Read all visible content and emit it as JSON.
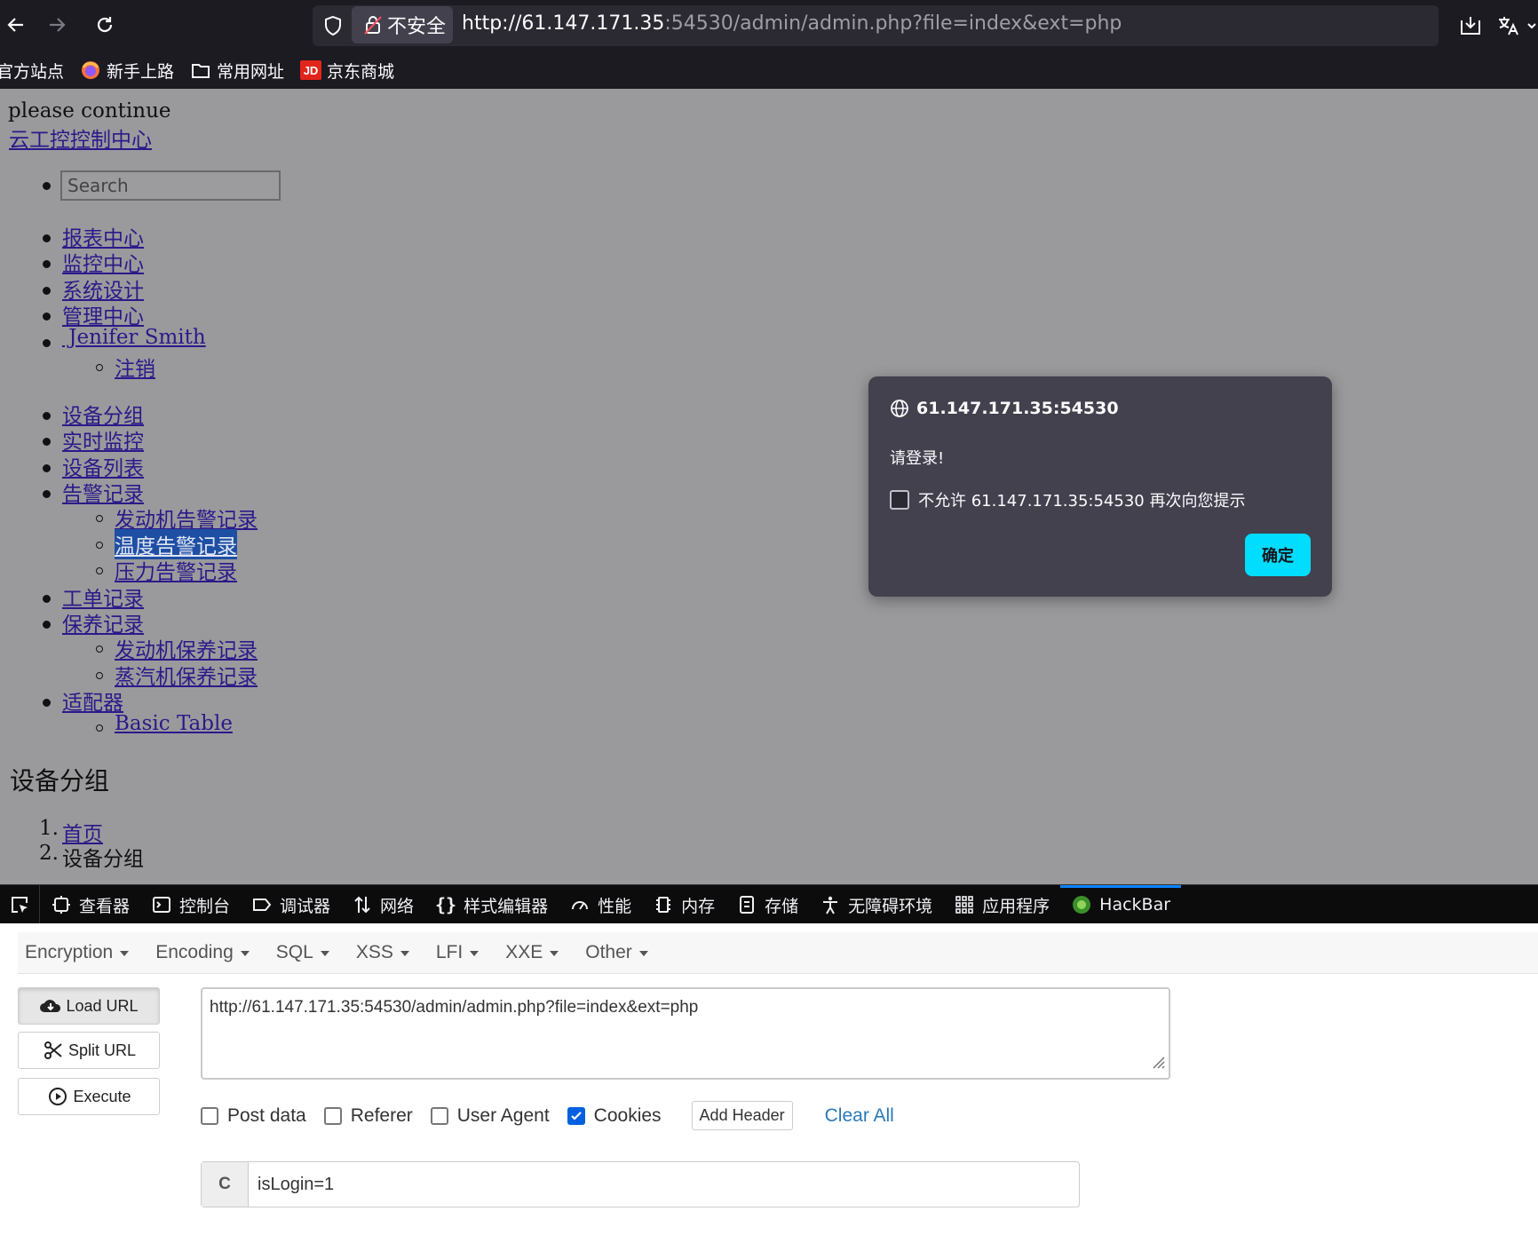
{
  "browser": {
    "security_label": "不安全",
    "url_host": "http://61.147.171.35",
    "url_rest": ":54530/admin/admin.php?file=index&ext=php",
    "bookmarks": [
      "官方站点",
      "新手上路",
      "常用网址",
      "京东商城"
    ]
  },
  "page": {
    "message": "please continue",
    "site_title": "云工控控制中心",
    "search_placeholder": "Search",
    "top_nav": [
      "报表中心",
      "监控中心",
      "系统设计",
      "管理中心",
      " Jenifer Smith"
    ],
    "user_sub": [
      "注销"
    ],
    "side_nav": {
      "device_group": "设备分组",
      "realtime": "实时监控",
      "device_list": "设备列表",
      "alarm": "告警记录",
      "alarm_sub": [
        "发动机告警记录",
        "温度告警记录",
        "压力告警记录"
      ],
      "work_order": "工单记录",
      "maintenance": "保养记录",
      "maintenance_sub": [
        "发动机保养记录",
        "蒸汽机保养记录"
      ],
      "adapter": "适配器",
      "adapter_sub": [
        "Basic Table"
      ]
    },
    "heading": "设备分组",
    "breadcrumb": [
      {
        "num": "1.",
        "label": "首页"
      },
      {
        "num": "2.",
        "label": "设备分组"
      }
    ]
  },
  "dialog": {
    "origin": "61.147.171.35:54530",
    "message": "请登录!",
    "checkbox_label": "不允许 61.147.171.35:54530 再次向您提示",
    "ok_label": "确定"
  },
  "devtools": {
    "tabs": [
      "查看器",
      "控制台",
      "调试器",
      "网络",
      "样式编辑器",
      "性能",
      "内存",
      "存储",
      "无障碍环境",
      "应用程序",
      "HackBar"
    ],
    "active_tab": "HackBar"
  },
  "hackbar": {
    "menus": [
      "Encryption",
      "Encoding",
      "SQL",
      "XSS",
      "LFI",
      "XXE",
      "Other"
    ],
    "buttons": {
      "load": "Load URL",
      "split": "Split URL",
      "execute": "Execute"
    },
    "url_value": "http://61.147.171.35:54530/admin/admin.php?file=index&ext=php",
    "options": [
      {
        "label": "Post data",
        "checked": false
      },
      {
        "label": "Referer",
        "checked": false
      },
      {
        "label": "User Agent",
        "checked": false
      },
      {
        "label": "Cookies",
        "checked": true
      }
    ],
    "add_header": "Add Header",
    "clear_all": "Clear All",
    "cookie_label": "C",
    "cookie_value": "isLogin=1"
  }
}
